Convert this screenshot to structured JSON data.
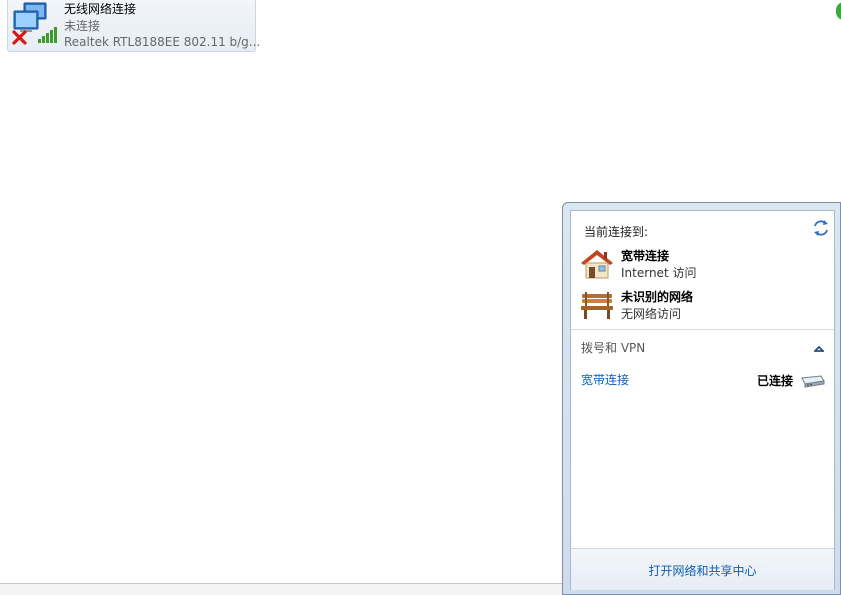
{
  "adapter": {
    "name": "无线网络连接",
    "status": "未连接",
    "device": "Realtek RTL8188EE 802.11 b/g...",
    "icons": [
      "monitor-network-icon",
      "disconnected-x-icon",
      "signal-bars-icon"
    ]
  },
  "flyout": {
    "current_label": "当前连接到:",
    "connections": [
      {
        "title": "宽带连接",
        "subtitle": "Internet 访问",
        "icon": "house-icon"
      },
      {
        "title": "未识别的网络",
        "subtitle": "无网络访问",
        "icon": "bench-icon"
      }
    ],
    "section_title": "拨号和 VPN",
    "vpn": {
      "name": "宽带连接",
      "status": "已连接",
      "icon": "modem-icon"
    },
    "footer_link": "打开网络和共享中心",
    "colors": {
      "link": "#0a5fb4",
      "frame": "#cfdced"
    }
  }
}
